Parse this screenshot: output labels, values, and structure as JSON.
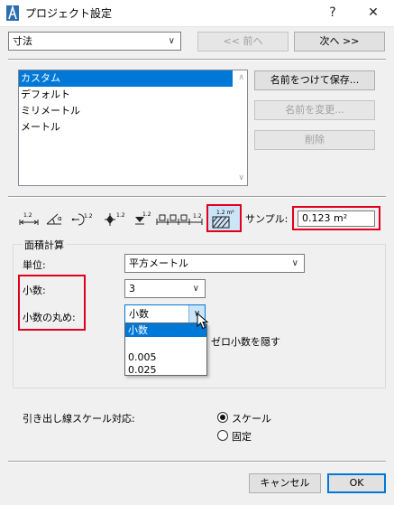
{
  "window": {
    "title": "プロジェクト設定",
    "help_label": "?",
    "close_label": "✕"
  },
  "toolbar": {
    "category_value": "寸法",
    "prev_label": "<< 前へ",
    "next_label": "次へ >>"
  },
  "presets": {
    "items": [
      {
        "label": "カスタム",
        "selected": true
      },
      {
        "label": "デフォルト",
        "selected": false
      },
      {
        "label": "ミリメートル",
        "selected": false
      },
      {
        "label": "メートル",
        "selected": false
      }
    ],
    "save_label": "名前をつけて保存...",
    "rename_label": "名前を変更...",
    "delete_label": "削除"
  },
  "dim_tools": {
    "tool_labels": [
      "1.2",
      "α",
      "1.2",
      "1.2",
      "1.2",
      "1.2",
      "1.2 m²"
    ],
    "sample_label": "サンプル:",
    "sample_value": "0.123 m²"
  },
  "area": {
    "group_label": "面積計算",
    "unit_label": "単位:",
    "unit_value": "平方メートル",
    "decimals_label": "小数:",
    "decimals_value": "3",
    "rounding_label": "小数の丸め:",
    "rounding_value": "小数",
    "rounding_options": [
      "小数",
      "0.005",
      "0.025"
    ],
    "hide_zero_label": "ゼロ小数を隠す"
  },
  "leader": {
    "label": "引き出し線スケール対応:",
    "option_scale": "スケール",
    "option_fixed": "固定"
  },
  "footer": {
    "cancel_label": "キャンセル",
    "ok_label": "OK"
  },
  "colors": {
    "highlight": "#e0001b",
    "selection": "#0078d7"
  }
}
